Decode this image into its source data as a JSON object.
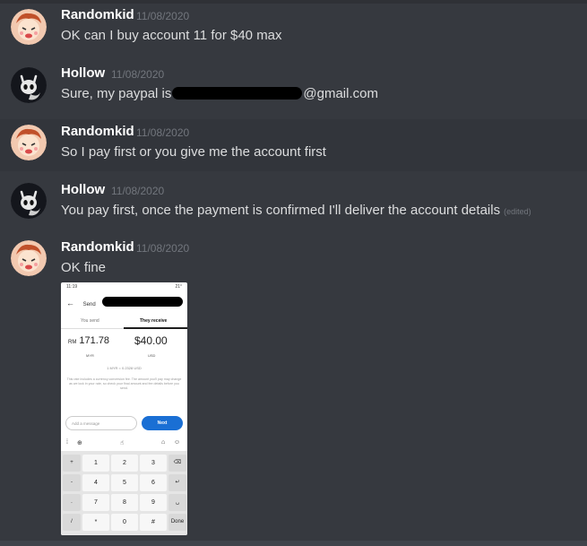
{
  "messages": [
    {
      "username": "Randomkid",
      "timestamp": "11/08/2020",
      "text": "OK can I buy account 11 for $40 max"
    },
    {
      "username": "Hollow",
      "timestamp": "11/08/2020",
      "text_before": "Sure, my paypal is",
      "text_after": "@gmail.com"
    },
    {
      "username": "Randomkid",
      "timestamp": "11/08/2020",
      "text": "So I pay first or you give me the account first"
    },
    {
      "username": "Hollow",
      "timestamp": "11/08/2020",
      "text": "You pay first, once the payment is confirmed I'll deliver the account details",
      "edited": "(edited)"
    },
    {
      "username": "Randomkid",
      "timestamp": "11/08/2020",
      "text": "OK fine"
    }
  ],
  "attachment": {
    "status_time": "11:19",
    "status_right": "21°",
    "send_label": "Send",
    "send_suffix": "@...",
    "tab_you_send": "You send",
    "tab_they_receive": "They receive",
    "send_currency_prefix": "RM",
    "send_amount": "171.78",
    "receive_amount": "$40.00",
    "send_currency": "MYR",
    "receive_currency": "USD",
    "rate": "1 MYR = 0.2328 USD",
    "note": "This rate includes a currency conversion fee. The amount you'll pay may change as we lock in your rate, so check your final amount and fee details before you send.",
    "message_placeholder": "Add a message",
    "next_label": "Next",
    "keys": [
      [
        "+",
        "1",
        "2",
        "3",
        "⌫"
      ],
      [
        "-",
        "4",
        "5",
        "6",
        "↵"
      ],
      [
        ".",
        "7",
        "8",
        "9",
        "␣"
      ],
      [
        "/",
        "*",
        "0",
        "#",
        "Done"
      ]
    ]
  },
  "colors": {
    "background": "#36393f",
    "highlight": "#32353b",
    "username": "#ffffff",
    "timestamp": "#72767d",
    "text": "#dcddde",
    "next_button": "#1a6fd4"
  }
}
